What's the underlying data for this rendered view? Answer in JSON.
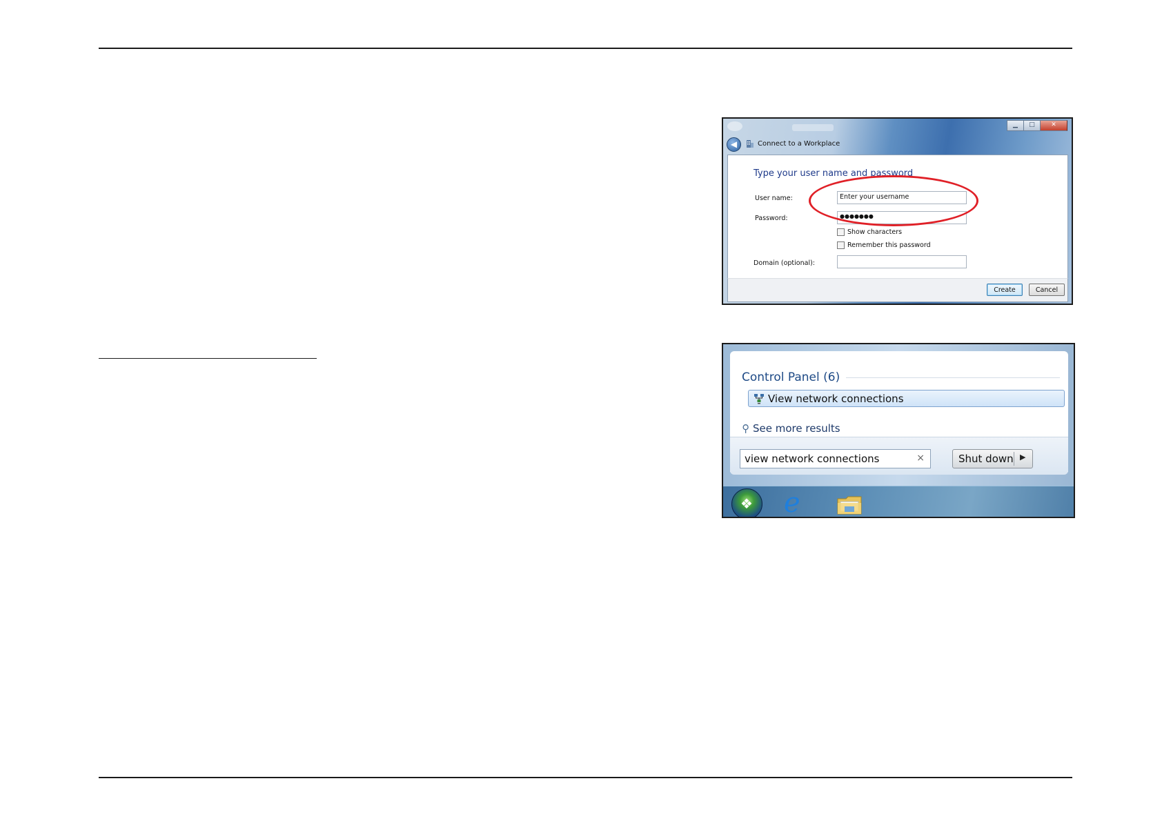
{
  "dialog": {
    "title": "Connect to a Workplace",
    "window_controls": {
      "minimize": "▁",
      "maximize": "□",
      "close": "✕"
    },
    "back_icon": "arrow-left-icon",
    "heading": "Type your user name and password",
    "username_label": "User name:",
    "username_value": "Enter your username",
    "password_label": "Password:",
    "password_value": "●●●●●●●",
    "show_characters": "Show characters",
    "remember_password": "Remember this password",
    "domain_label": "Domain (optional):",
    "domain_value": "",
    "create_button": "Create",
    "cancel_button": "Cancel",
    "highlight_color": "#e02027"
  },
  "start_menu": {
    "section_heading": "Control Panel (6)",
    "result_item": "View network connections",
    "see_more": "See more results",
    "search_value": "view network connections",
    "clear_icon": "×",
    "shutdown_label": "Shut down",
    "shutdown_arrow": "▶",
    "taskbar_icons": [
      "start-orb-icon",
      "internet-explorer-icon",
      "file-explorer-icon"
    ]
  }
}
